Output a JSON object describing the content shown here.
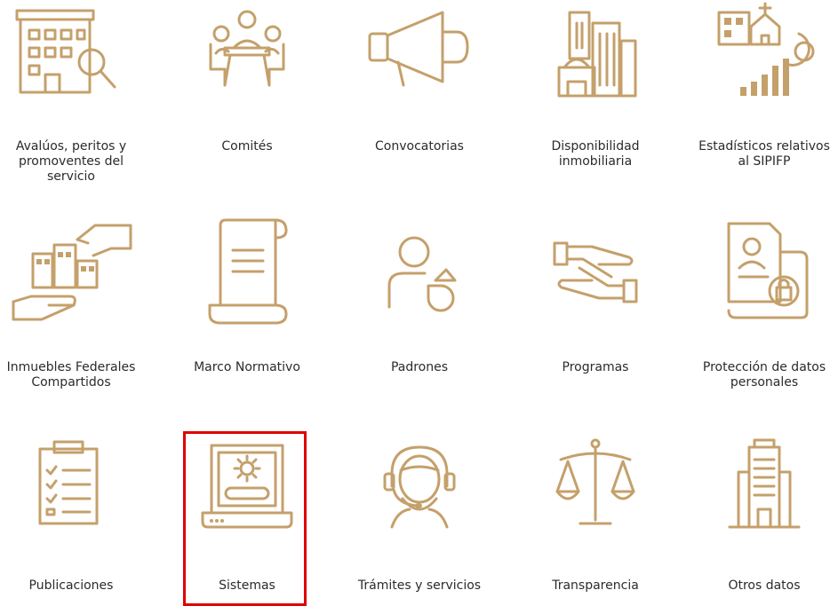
{
  "accent_color": "#c4a06b",
  "highlight_color": "#e00000",
  "tiles": [
    {
      "label": "Avalúos, peritos y promoventes del servicio",
      "icon": "building-search-icon"
    },
    {
      "label": "Comités",
      "icon": "meeting-table-icon"
    },
    {
      "label": "Convocatorias",
      "icon": "megaphone-icon"
    },
    {
      "label": "Disponibilidad inmobiliaria",
      "icon": "city-buildings-icon"
    },
    {
      "label": "Estadísticos relativos al SIPIFP",
      "icon": "statistics-chart-icon"
    },
    {
      "label": "Inmuebles Federales Compartidos",
      "icon": "shared-buildings-hands-icon"
    },
    {
      "label": "Marco Normativo",
      "icon": "scroll-document-icon"
    },
    {
      "label": "Padrones",
      "icon": "user-pie-chart-icon"
    },
    {
      "label": "Programas",
      "icon": "handshake-icon"
    },
    {
      "label": "Protección de datos personales",
      "icon": "id-folder-lock-icon"
    },
    {
      "label": "Publicaciones",
      "icon": "clipboard-list-icon"
    },
    {
      "label": "Sistemas",
      "icon": "laptop-gear-icon"
    },
    {
      "label": "Trámites y servicios",
      "icon": "headset-agent-icon"
    },
    {
      "label": "Transparencia",
      "icon": "balance-scale-icon"
    },
    {
      "label": "Otros datos",
      "icon": "office-tower-icon"
    }
  ]
}
